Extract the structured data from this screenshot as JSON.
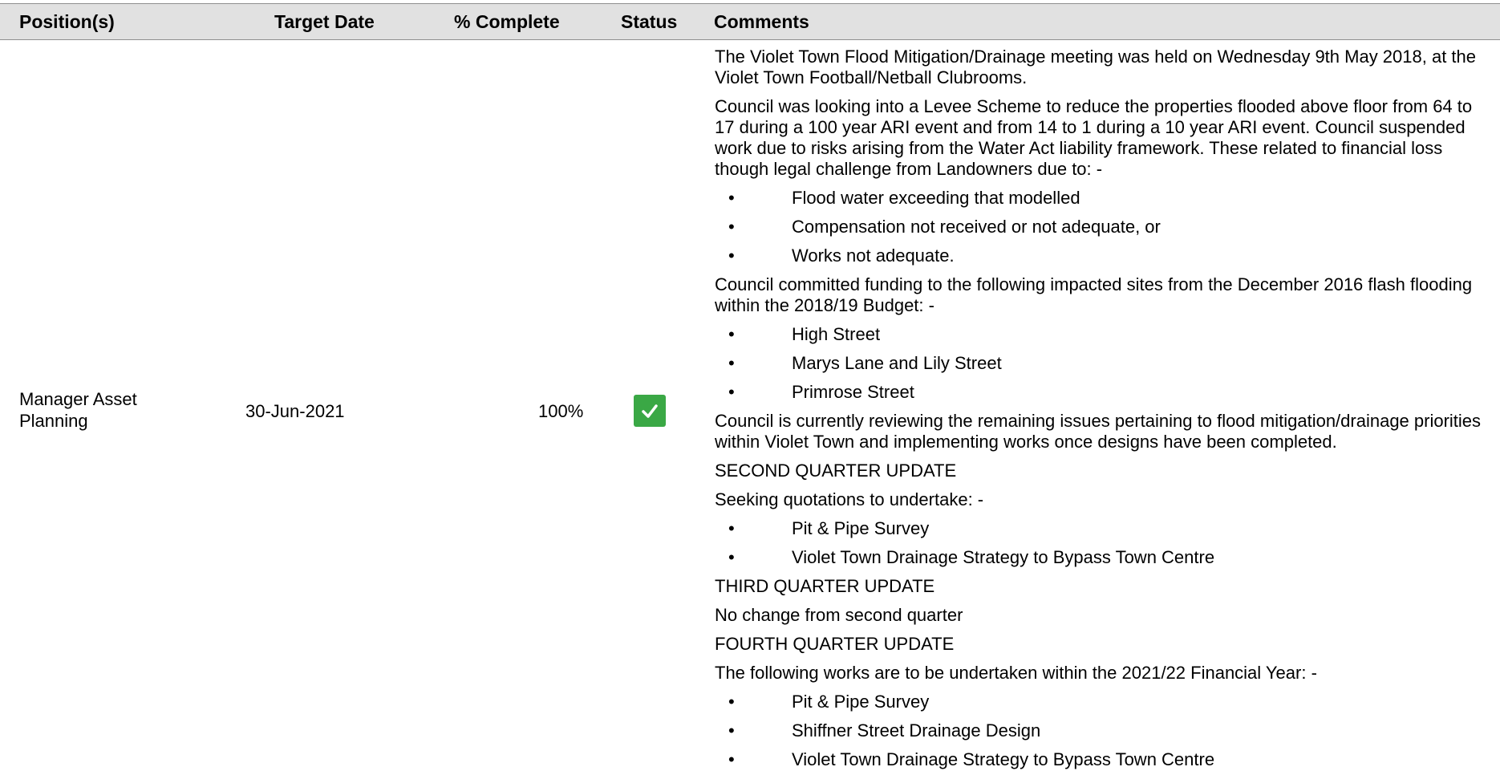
{
  "table": {
    "headers": {
      "position": "Position(s)",
      "target_date": "Target Date",
      "pct_complete": "% Complete",
      "status": "Status",
      "comments": "Comments"
    },
    "row": {
      "position": "Manager Asset Planning",
      "target_date": "30-Jun-2021",
      "pct_complete": "100%",
      "status_color": "#3aa845",
      "status_icon": "checkmark-icon",
      "comments": [
        {
          "type": "para",
          "text": "The Violet Town Flood Mitigation/Drainage meeting was held on Wednesday 9th May 2018, at the Violet Town Football/Netball Clubrooms."
        },
        {
          "type": "para",
          "text": "Council was looking into a Levee Scheme to reduce the properties flooded above floor from 64 to 17 during a 100 year ARI event and from 14 to 1 during a 10 year ARI event. Council suspended work due to risks arising from the Water Act liability framework. These related to financial loss though legal challenge from Landowners due to: -"
        },
        {
          "type": "bullet",
          "text": "Flood water exceeding that modelled"
        },
        {
          "type": "bullet",
          "text": "Compensation not received or not adequate, or"
        },
        {
          "type": "bullet",
          "text": "Works not adequate."
        },
        {
          "type": "para",
          "text": "Council committed funding to the following impacted sites from the December 2016 flash flooding within the 2018/19 Budget: -"
        },
        {
          "type": "bullet",
          "text": "High Street"
        },
        {
          "type": "bullet",
          "text": "Marys Lane and Lily Street"
        },
        {
          "type": "bullet",
          "text": "Primrose Street"
        },
        {
          "type": "para",
          "text": "Council is currently reviewing the remaining issues pertaining to flood mitigation/drainage priorities within Violet Town and implementing works once designs have been completed."
        },
        {
          "type": "para",
          "text": "SECOND QUARTER UPDATE"
        },
        {
          "type": "para",
          "text": "Seeking quotations to undertake: -"
        },
        {
          "type": "bullet",
          "text": "Pit & Pipe Survey"
        },
        {
          "type": "bullet",
          "text": "Violet Town Drainage Strategy to Bypass Town Centre"
        },
        {
          "type": "para",
          "text": "THIRD QUARTER UPDATE"
        },
        {
          "type": "para",
          "text": "No change from second quarter"
        },
        {
          "type": "para",
          "text": "FOURTH QUARTER UPDATE"
        },
        {
          "type": "para",
          "text": "The following works are to be undertaken within the 2021/22 Financial Year: -"
        },
        {
          "type": "bullet",
          "text": "Pit & Pipe Survey"
        },
        {
          "type": "bullet",
          "text": "Shiffner Street Drainage Design"
        },
        {
          "type": "bullet",
          "text": "Violet Town Drainage Strategy to Bypass Town Centre"
        }
      ]
    },
    "bullet_char": "•"
  }
}
